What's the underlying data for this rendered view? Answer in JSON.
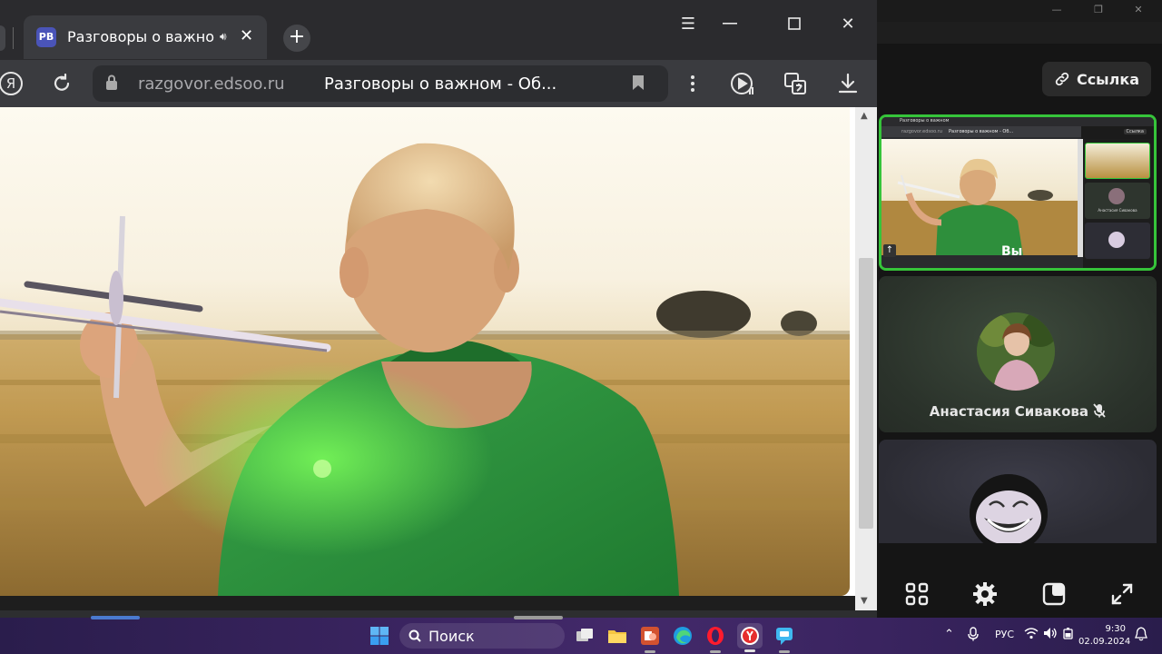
{
  "browser": {
    "tab": {
      "favicon_text": "РВ",
      "title": "Разговоры о важном",
      "close": "✕"
    },
    "new_tab": "+",
    "window_controls": {
      "menu": "☰",
      "maximize": "☐",
      "close": "✕"
    },
    "nav": {
      "yandex_logo": "Я"
    },
    "address": {
      "domain": "razgovor.edsoo.ru",
      "page_title": "Разговоры о важном - Об..."
    }
  },
  "call": {
    "link_button": "Ссылка",
    "self_label": "Вы",
    "participants": [
      {
        "name": "Анастасия Сивакова"
      }
    ],
    "mini_preview": {
      "tab_title": "Разговоры о важном",
      "domain": "razgovor.edsoo.ru",
      "page_title": "Разговоры о важном - Об...",
      "link_button": "Ссылка",
      "self_label": "Вы",
      "participant": "Анастасия Сивакова"
    }
  },
  "taskbar": {
    "search_placeholder": "Поиск",
    "language": "РУС",
    "time": "9:30",
    "date": "02.09.2024"
  },
  "colors": {
    "active_speaker_border": "#36c43a",
    "yandex_red": "#e62e2e",
    "favicon_blue": "#4a54b8"
  }
}
